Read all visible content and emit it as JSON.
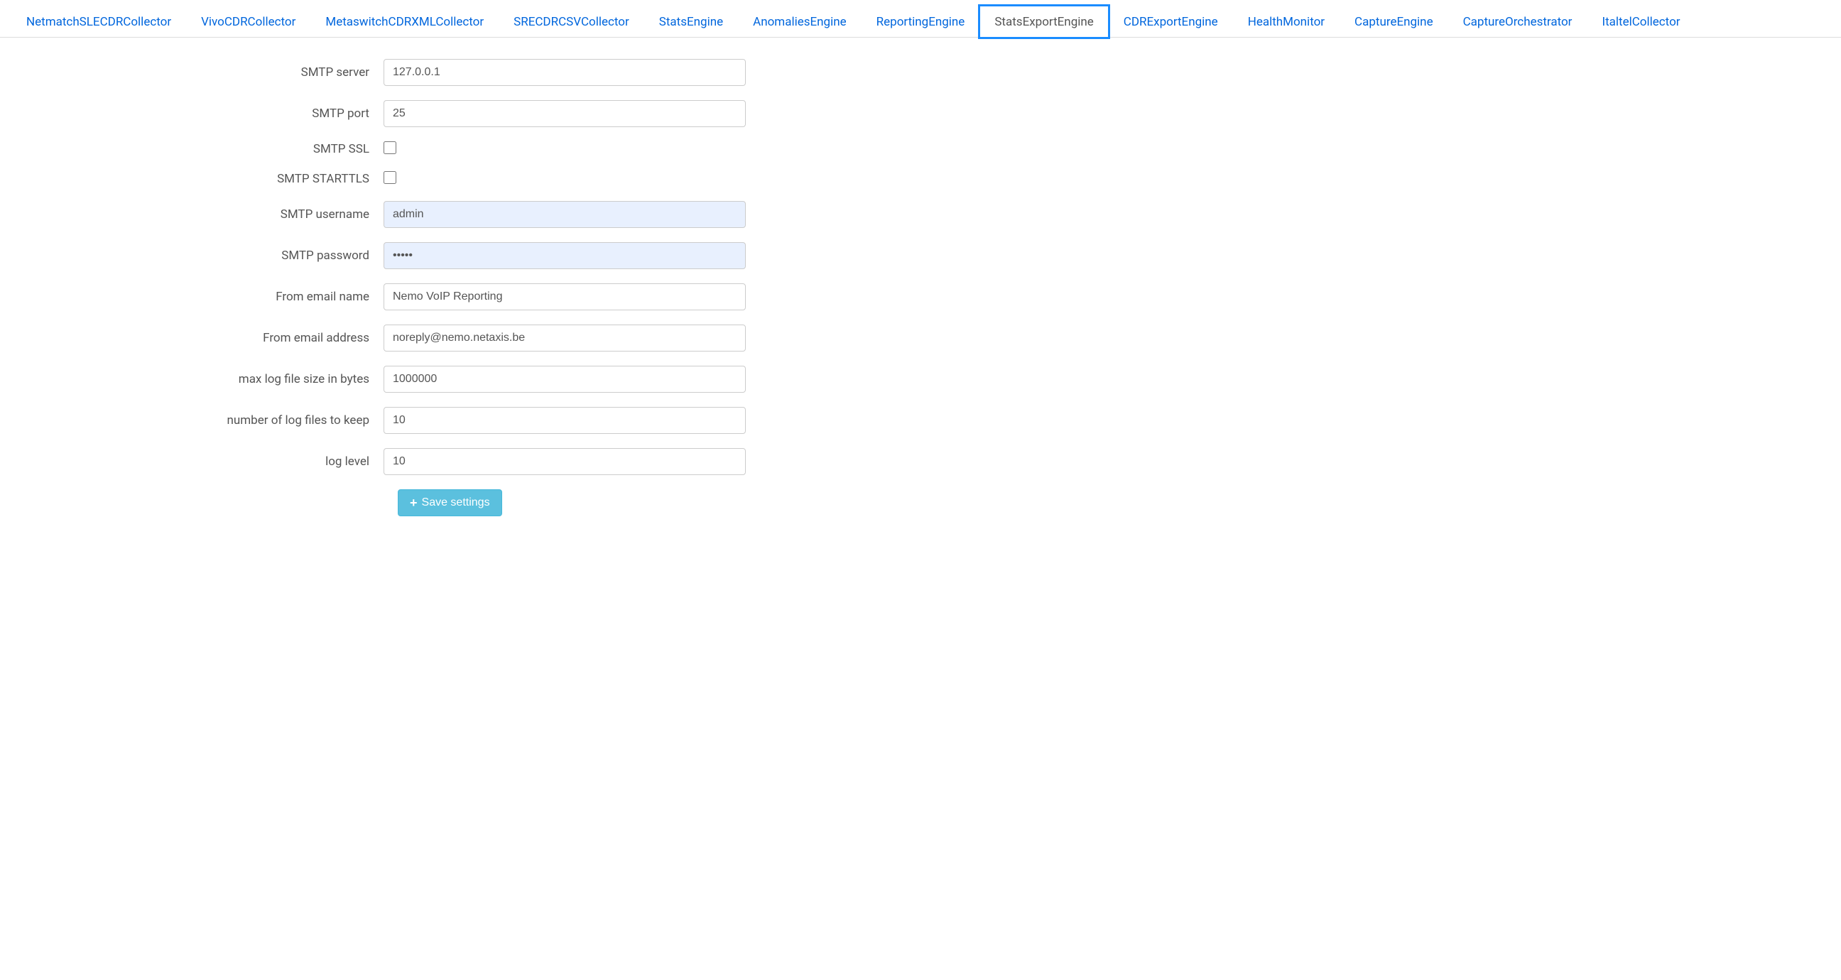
{
  "tabs": [
    {
      "label": "NetmatchSLECDRCollector",
      "active": false
    },
    {
      "label": "VivoCDRCollector",
      "active": false
    },
    {
      "label": "MetaswitchCDRXMLCollector",
      "active": false
    },
    {
      "label": "SRECDRCSVCollector",
      "active": false
    },
    {
      "label": "StatsEngine",
      "active": false
    },
    {
      "label": "AnomaliesEngine",
      "active": false
    },
    {
      "label": "ReportingEngine",
      "active": false
    },
    {
      "label": "StatsExportEngine",
      "active": true,
      "highlighted": true
    },
    {
      "label": "CDRExportEngine",
      "active": false
    },
    {
      "label": "HealthMonitor",
      "active": false
    },
    {
      "label": "CaptureEngine",
      "active": false
    },
    {
      "label": "CaptureOrchestrator",
      "active": false
    },
    {
      "label": "ItaltelCollector",
      "active": false
    }
  ],
  "form": {
    "smtp_server": {
      "label": "SMTP server",
      "value": "127.0.0.1"
    },
    "smtp_port": {
      "label": "SMTP port",
      "value": "25"
    },
    "smtp_ssl": {
      "label": "SMTP SSL",
      "checked": false
    },
    "smtp_starttls": {
      "label": "SMTP STARTTLS",
      "checked": false
    },
    "smtp_username": {
      "label": "SMTP username",
      "value": "admin"
    },
    "smtp_password": {
      "label": "SMTP password",
      "value": "•••••"
    },
    "from_email_name": {
      "label": "From email name",
      "value": "Nemo VoIP Reporting"
    },
    "from_email_address": {
      "label": "From email address",
      "value": "noreply@nemo.netaxis.be"
    },
    "max_log_file_size": {
      "label": "max log file size in bytes",
      "value": "1000000"
    },
    "num_log_files": {
      "label": "number of log files to keep",
      "value": "10"
    },
    "log_level": {
      "label": "log level",
      "value": "10"
    }
  },
  "buttons": {
    "save": "Save settings"
  }
}
